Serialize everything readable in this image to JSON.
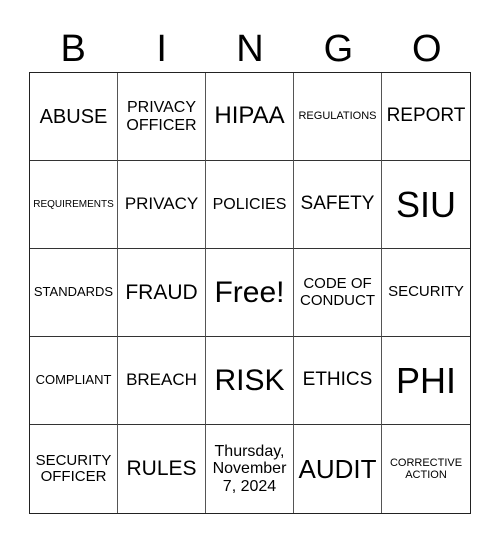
{
  "header": [
    "B",
    "I",
    "N",
    "G",
    "O"
  ],
  "cells": [
    {
      "text": "ABUSE",
      "size": "s20"
    },
    {
      "text": "PRIVACY OFFICER",
      "size": "s16"
    },
    {
      "text": "HIPAA",
      "size": "s24"
    },
    {
      "text": "REGULATIONS",
      "size": "s11"
    },
    {
      "text": "REPORT",
      "size": "s19"
    },
    {
      "text": "REQUIREMENTS",
      "size": "s10"
    },
    {
      "text": "PRIVACY",
      "size": "s17"
    },
    {
      "text": "POLICIES",
      "size": "s16"
    },
    {
      "text": "SAFETY",
      "size": "s19"
    },
    {
      "text": "SIU",
      "size": "s36"
    },
    {
      "text": "STANDARDS",
      "size": "s13"
    },
    {
      "text": "FRAUD",
      "size": "s21"
    },
    {
      "text": "Free!",
      "size": "s30"
    },
    {
      "text": "CODE OF CONDUCT",
      "size": "s15"
    },
    {
      "text": "SECURITY",
      "size": "s15"
    },
    {
      "text": "COMPLIANT",
      "size": "s13"
    },
    {
      "text": "BREACH",
      "size": "s17"
    },
    {
      "text": "RISK",
      "size": "s30"
    },
    {
      "text": "ETHICS",
      "size": "s19"
    },
    {
      "text": "PHI",
      "size": "s36"
    },
    {
      "text": "SECURITY OFFICER",
      "size": "s15"
    },
    {
      "text": "RULES",
      "size": "s21"
    },
    {
      "text": "Thursday, November 7, 2024",
      "size": "s16"
    },
    {
      "text": "AUDIT",
      "size": "s26"
    },
    {
      "text": "CORRECTIVE ACTION",
      "size": "s11"
    }
  ]
}
